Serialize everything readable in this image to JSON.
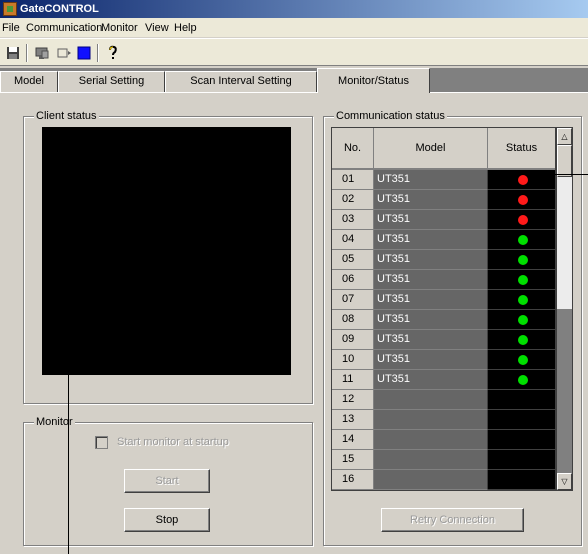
{
  "window": {
    "title": "GateCONTROL"
  },
  "menu": [
    "File",
    "Communication",
    "Monitor",
    "View",
    "Help"
  ],
  "toolbar": {
    "icons": [
      "save-icon",
      "connect-icon",
      "monitor-icon",
      "stop-icon",
      "help-icon"
    ]
  },
  "tabs": [
    {
      "label": "Model",
      "active": false
    },
    {
      "label": "Serial Setting",
      "active": false
    },
    {
      "label": "Scan Interval Setting",
      "active": false
    },
    {
      "label": "Monitor/Status",
      "active": true
    }
  ],
  "client_status": {
    "legend": "Client status"
  },
  "monitor": {
    "legend": "Monitor",
    "checkbox_label": "Start monitor at startup",
    "checkbox_checked": false,
    "start_label": "Start",
    "stop_label": "Stop"
  },
  "communication": {
    "legend": "Communication status",
    "headers": {
      "no": "No.",
      "model": "Model",
      "status": "Status"
    },
    "rows": [
      {
        "no": "01",
        "model": "UT351",
        "status": "error"
      },
      {
        "no": "02",
        "model": "UT351",
        "status": "error"
      },
      {
        "no": "03",
        "model": "UT351",
        "status": "error"
      },
      {
        "no": "04",
        "model": "UT351",
        "status": "ok"
      },
      {
        "no": "05",
        "model": "UT351",
        "status": "ok"
      },
      {
        "no": "06",
        "model": "UT351",
        "status": "ok"
      },
      {
        "no": "07",
        "model": "UT351",
        "status": "ok"
      },
      {
        "no": "08",
        "model": "UT351",
        "status": "ok"
      },
      {
        "no": "09",
        "model": "UT351",
        "status": "ok"
      },
      {
        "no": "10",
        "model": "UT351",
        "status": "ok"
      },
      {
        "no": "11",
        "model": "UT351",
        "status": "ok"
      },
      {
        "no": "12",
        "model": "",
        "status": "none"
      },
      {
        "no": "13",
        "model": "",
        "status": "none"
      },
      {
        "no": "14",
        "model": "",
        "status": "none"
      },
      {
        "no": "15",
        "model": "",
        "status": "none"
      },
      {
        "no": "16",
        "model": "",
        "status": "none"
      }
    ],
    "retry_label": "Retry Connection"
  },
  "colors": {
    "status_ok": "#00e000",
    "status_error": "#ff1a1a",
    "title_start": "#0a246a",
    "title_end": "#a6caf0"
  }
}
